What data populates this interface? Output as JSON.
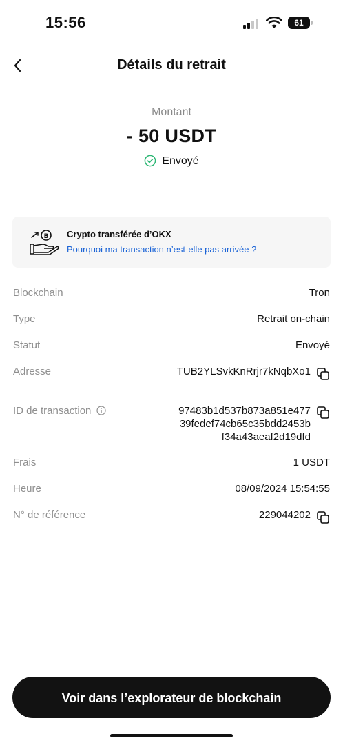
{
  "status_bar": {
    "time": "15:56",
    "battery": "61"
  },
  "header": {
    "title": "Détails du retrait"
  },
  "amount": {
    "label": "Montant",
    "value": "- 50 USDT",
    "status": "Envoyé"
  },
  "info_card": {
    "title": "Crypto transférée d’OKX",
    "link": "Pourquoi ma transaction n’est-elle pas arrivée ?"
  },
  "details": {
    "blockchain": {
      "label": "Blockchain",
      "value": "Tron"
    },
    "type": {
      "label": "Type",
      "value": "Retrait on-chain"
    },
    "status": {
      "label": "Statut",
      "value": "Envoyé"
    },
    "address": {
      "label": "Adresse",
      "value": "TUB2YLSvkKnRrjr7kNqbXo1"
    },
    "tx_id": {
      "label": "ID de transaction",
      "lines": [
        "97483b1d537b873a851e477",
        "39fedef74cb65c35bdd2453b",
        "f34a43aeaf2d19dfd"
      ]
    },
    "fees": {
      "label": "Frais",
      "value": "1 USDT"
    },
    "time": {
      "label": "Heure",
      "value": "08/09/2024 15:54:55"
    },
    "reference": {
      "label": "N° de référence",
      "value": "229044202"
    }
  },
  "cta": {
    "label": "Voir dans l’explorateur de blockchain"
  },
  "icons": [
    "signal-icon",
    "wifi-icon",
    "battery-icon",
    "back-arrow-icon",
    "check-circle-icon",
    "hand-crypto-icon",
    "info-icon",
    "copy-icon"
  ],
  "colors": {
    "link": "#1a63d6",
    "success": "#2bb673",
    "cta_bg": "#121212"
  }
}
